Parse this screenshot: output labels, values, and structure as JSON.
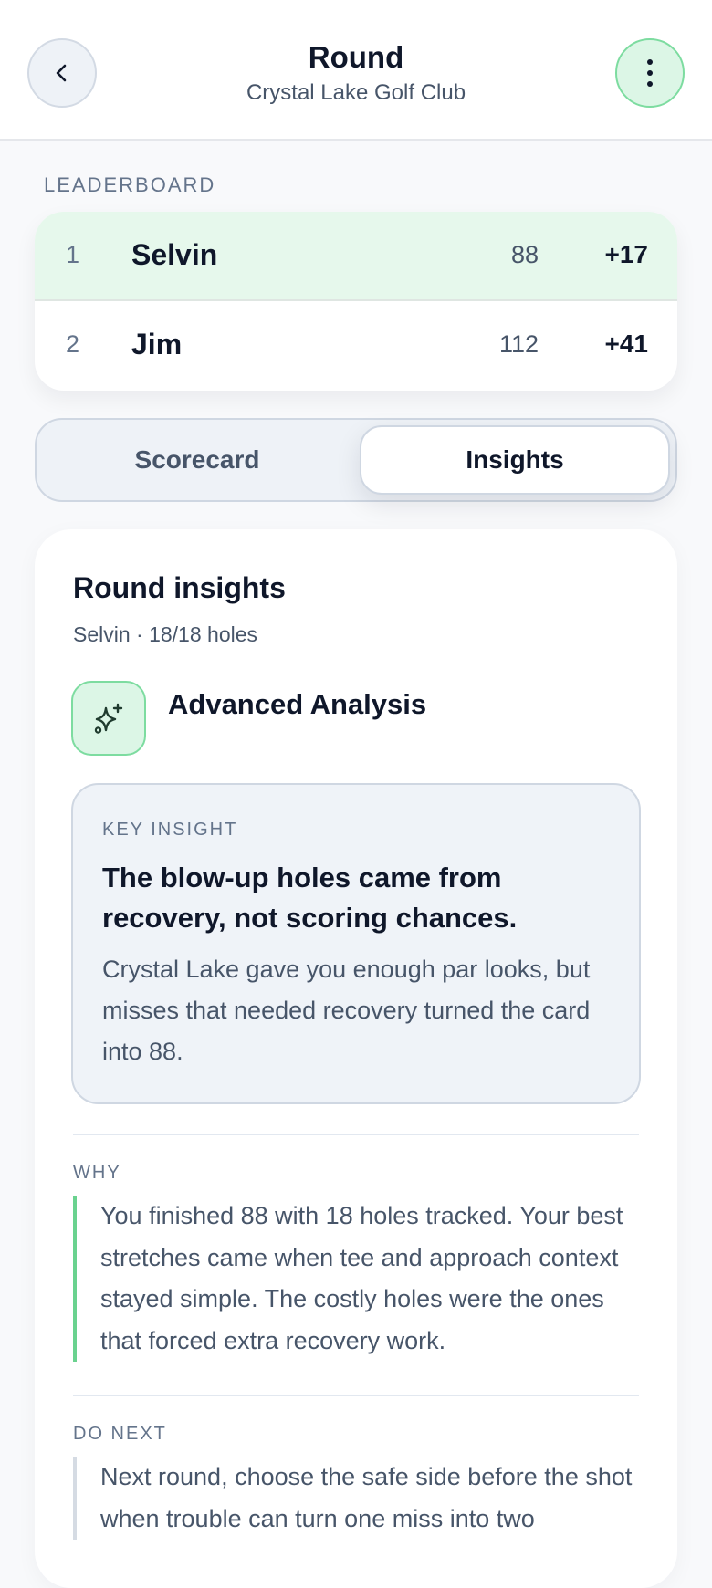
{
  "header": {
    "title": "Round",
    "subtitle": "Crystal Lake Golf Club"
  },
  "leaderboard": {
    "label": "LEADERBOARD",
    "rows": [
      {
        "rank": "1",
        "name": "Selvin",
        "score": "88",
        "diff": "+17"
      },
      {
        "rank": "2",
        "name": "Jim",
        "score": "112",
        "diff": "+41"
      }
    ]
  },
  "tabs": {
    "scorecard": "Scorecard",
    "insights": "Insights",
    "active": "insights"
  },
  "insights": {
    "title": "Round insights",
    "meta": "Selvin · 18/18 holes",
    "analysis_title": "Advanced Analysis",
    "analysis_icon": "sparkles-icon",
    "key_insight": {
      "label": "KEY INSIGHT",
      "headline": "The blow-up holes came from recovery, not scoring chances.",
      "body": "Crystal Lake gave you enough par looks, but misses that needed recovery turned the card into 88."
    },
    "why": {
      "label": "WHY",
      "body": "You finished 88 with 18 holes tracked. Your best stretches came when tee and approach context stayed simple. The costly holes were the ones that forced extra recovery work."
    },
    "do_next": {
      "label": "DO NEXT",
      "body": "Next round, choose the safe side before the shot when trouble can turn one miss into two"
    }
  },
  "colors": {
    "accent_green": "#7ddca0",
    "leader_row": "#e6f8ec",
    "text_primary": "#0f172a",
    "text_secondary": "#475569"
  }
}
